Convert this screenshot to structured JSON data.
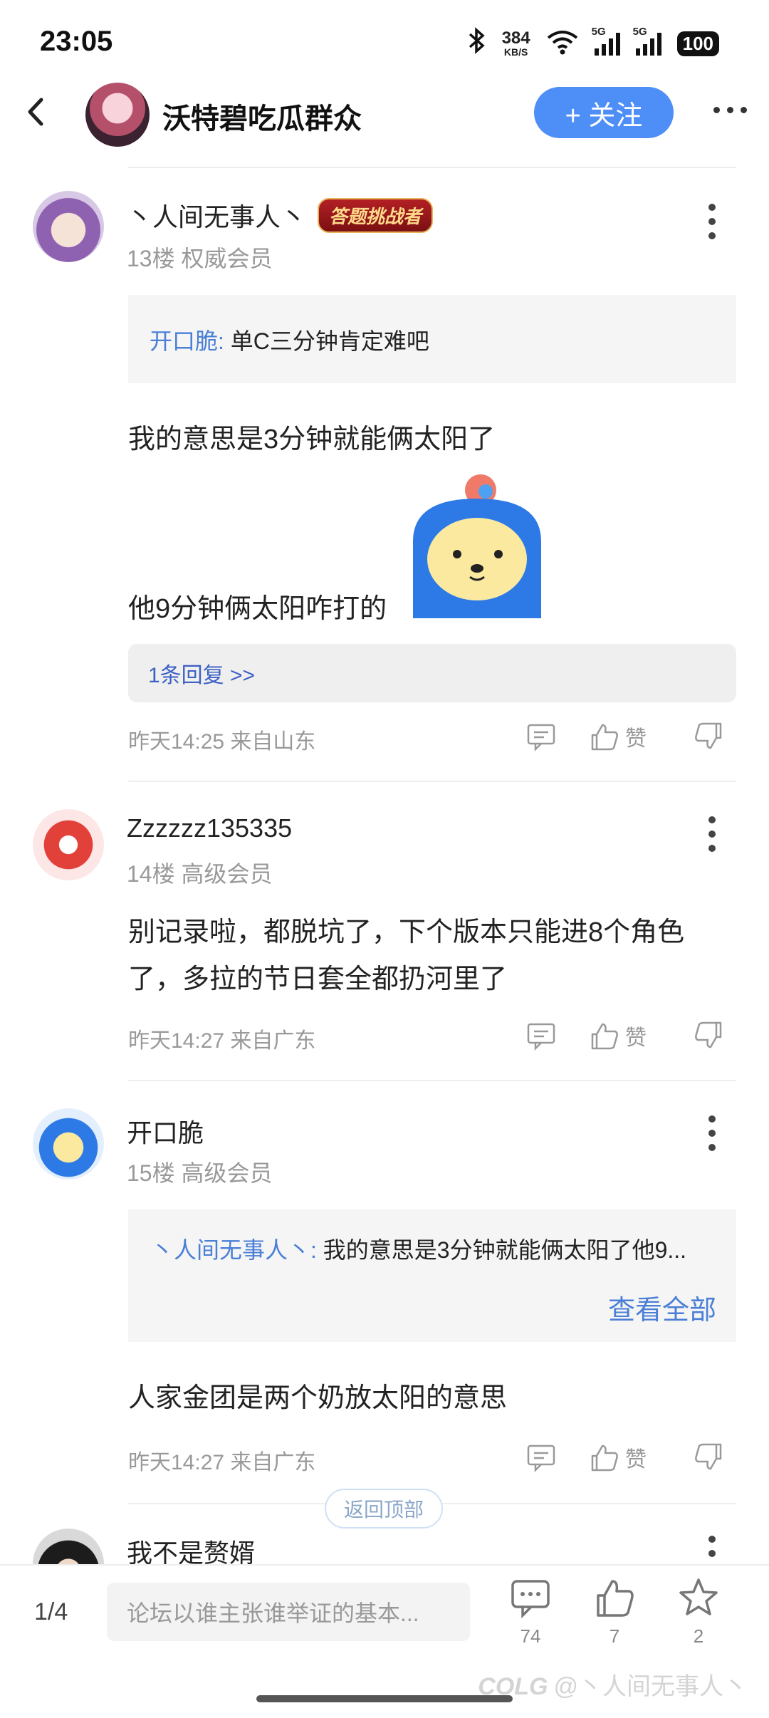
{
  "status_bar": {
    "time": "23:05",
    "speed_value": "384",
    "speed_unit": "KB/S",
    "net_tag_1": "5G",
    "net_tag_2": "5G",
    "battery": "100"
  },
  "header": {
    "title": "沃特碧吃瓜群众",
    "follow_label": "+ 关注"
  },
  "posts": [
    {
      "username": "丶人间无事人丶",
      "badge": "答题挑战者",
      "meta": "13楼 权威会员",
      "quote_user": "开口脆:",
      "quote_text": "单C三分钟肯定难吧",
      "line1": "我的意思是3分钟就能俩太阳了",
      "line2": "他9分钟俩太阳咋打的",
      "replies": "1条回复 >>",
      "time": "昨天14:25 来自山东",
      "like_label": "赞"
    },
    {
      "username": "Zzzzzz135335",
      "meta": "14楼 高级会员",
      "line1": "别记录啦，都脱坑了，下个版本只能进8个角色",
      "line2": "了，多拉的节日套全都扔河里了",
      "time": "昨天14:27 来自广东",
      "like_label": "赞"
    },
    {
      "username": "开口脆",
      "meta": "15楼 高级会员",
      "quote_user": "丶人间无事人丶:",
      "quote_text": "我的意思是3分钟就能俩太阳了他9...",
      "view_all": "查看全部",
      "line1": "人家金团是两个奶放太阳的意思",
      "time": "昨天14:27 来自广东",
      "like_label": "赞"
    },
    {
      "username": "我不是赘婿"
    }
  ],
  "back_to_top": "返回顶部",
  "bottom_bar": {
    "page": "1/4",
    "input_placeholder": "论坛以谁主张谁举证的基本...",
    "comment_count": "74",
    "like_count": "7",
    "favorite_count": "2"
  },
  "watermark": "@丶人间无事人丶",
  "watermark_logo": "COLG",
  "colors": {
    "accent": "#4e8ef7",
    "link": "#4a7fd6"
  }
}
